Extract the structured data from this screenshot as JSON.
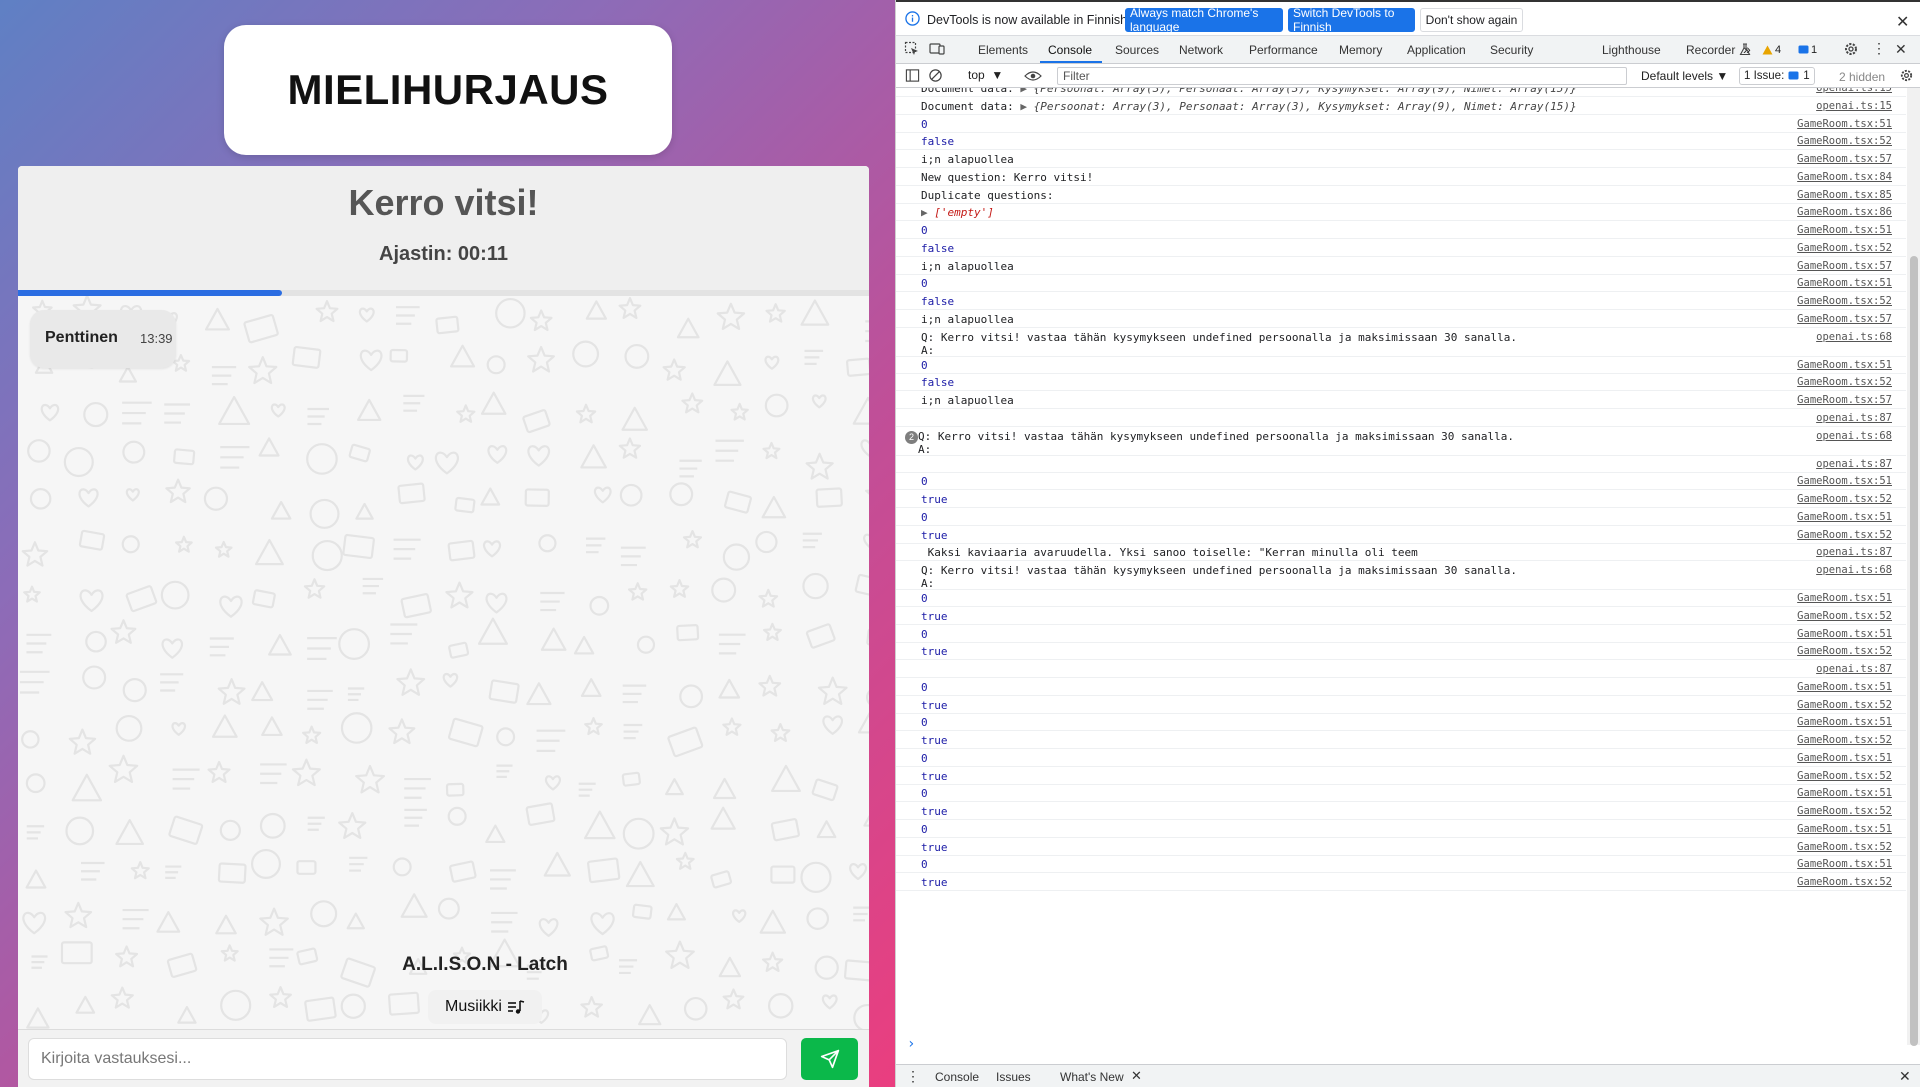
{
  "app": {
    "title": "MIELIHURJAUS",
    "question": "Kerro vitsi!",
    "timer": "Ajastin: 00:11",
    "progress_fraction": 0.31,
    "message": {
      "author": "Penttinen",
      "time": "13:39"
    },
    "song": "A.L.I.S.O.N - Latch",
    "music_label": "Musiikki",
    "input_placeholder": "Kirjoita vastauksesi...",
    "colors": {
      "accent": "#2b6de2",
      "send": "#0bb84a"
    }
  },
  "devtools": {
    "infobar": {
      "message": "DevTools is now available in Finnish!",
      "btn_match": "Always match Chrome's language",
      "btn_switch": "Switch DevTools to Finnish",
      "btn_dismiss": "Don't show again"
    },
    "tabs": [
      "Elements",
      "Console",
      "Sources",
      "Network",
      "Performance",
      "Memory",
      "Application",
      "Security",
      "Lighthouse",
      "Recorder"
    ],
    "active_tab": "Console",
    "warnings_count": "4",
    "info_count": "1",
    "context": "top",
    "filter_placeholder": "Filter",
    "levels": "Default levels",
    "issues_label": "1 Issue:",
    "issues_count": "1",
    "hidden": "2 hidden",
    "drawer_tabs": [
      "Console",
      "Issues",
      "What's New"
    ],
    "logs": [
      {
        "type": "obj",
        "prefix": "Document data: ",
        "text": "{Persoonat: Array(3), Personaat: Array(3), Kysymykset: Array(9), Nimet: Array(15)}",
        "src": "openai.ts:15"
      },
      {
        "type": "obj",
        "prefix": "Document data: ",
        "text": "{Persoonat: Array(3), Personaat: Array(3), Kysymykset: Array(9), Nimet: Array(15)}",
        "src": "openai.ts:15"
      },
      {
        "type": "num",
        "text": "0",
        "src": "GameRoom.tsx:51"
      },
      {
        "type": "bool",
        "text": "false",
        "src": "GameRoom.tsx:52"
      },
      {
        "type": "text",
        "text": "i;n alapuollea",
        "src": "GameRoom.tsx:57"
      },
      {
        "type": "text",
        "text": "New question: Kerro vitsi!",
        "src": "GameRoom.tsx:84"
      },
      {
        "type": "text",
        "text": "Duplicate questions:",
        "src": "GameRoom.tsx:85"
      },
      {
        "type": "arr",
        "text": "['empty']",
        "src": "GameRoom.tsx:86"
      },
      {
        "type": "num",
        "text": "0",
        "src": "GameRoom.tsx:51"
      },
      {
        "type": "bool",
        "text": "false",
        "src": "GameRoom.tsx:52"
      },
      {
        "type": "text",
        "text": "i;n alapuollea",
        "src": "GameRoom.tsx:57"
      },
      {
        "type": "num",
        "text": "0",
        "src": "GameRoom.tsx:51"
      },
      {
        "type": "bool",
        "text": "false",
        "src": "GameRoom.tsx:52"
      },
      {
        "type": "text",
        "text": "i;n alapuollea",
        "src": "GameRoom.tsx:57"
      },
      {
        "type": "text2",
        "text": "Q: Kerro vitsi! vastaa tähän kysymykseen undefined persoonalla ja maksimissaan 30 sanalla.\nA:",
        "src": "openai.ts:68"
      },
      {
        "type": "num",
        "text": "0",
        "src": "GameRoom.tsx:51"
      },
      {
        "type": "bool",
        "text": "false",
        "src": "GameRoom.tsx:52"
      },
      {
        "type": "text",
        "text": "i;n alapuollea",
        "src": "GameRoom.tsx:57"
      },
      {
        "type": "blank",
        "text": "",
        "src": "openai.ts:87"
      },
      {
        "type": "rep2",
        "count": "2",
        "text": "Q: Kerro vitsi! vastaa tähän kysymykseen undefined persoonalla ja maksimissaan 30 sanalla.\nA:",
        "src": "openai.ts:68"
      },
      {
        "type": "blank",
        "text": "",
        "src": "openai.ts:87"
      },
      {
        "type": "num",
        "text": "0",
        "src": "GameRoom.tsx:51"
      },
      {
        "type": "bool",
        "text": "true",
        "src": "GameRoom.tsx:52"
      },
      {
        "type": "num",
        "text": "0",
        "src": "GameRoom.tsx:51"
      },
      {
        "type": "bool",
        "text": "true",
        "src": "GameRoom.tsx:52"
      },
      {
        "type": "text",
        "text": " Kaksi kaviaaria avaruudella. Yksi sanoo toiselle: \"Kerran minulla oli teem",
        "src": "openai.ts:87"
      },
      {
        "type": "text2",
        "text": "Q: Kerro vitsi! vastaa tähän kysymykseen undefined persoonalla ja maksimissaan 30 sanalla.\nA:",
        "src": "openai.ts:68"
      },
      {
        "type": "num",
        "text": "0",
        "src": "GameRoom.tsx:51"
      },
      {
        "type": "bool",
        "text": "true",
        "src": "GameRoom.tsx:52"
      },
      {
        "type": "num",
        "text": "0",
        "src": "GameRoom.tsx:51"
      },
      {
        "type": "bool",
        "text": "true",
        "src": "GameRoom.tsx:52"
      },
      {
        "type": "blank",
        "text": "",
        "src": "openai.ts:87"
      },
      {
        "type": "num",
        "text": "0",
        "src": "GameRoom.tsx:51"
      },
      {
        "type": "bool",
        "text": "true",
        "src": "GameRoom.tsx:52"
      },
      {
        "type": "num",
        "text": "0",
        "src": "GameRoom.tsx:51"
      },
      {
        "type": "bool",
        "text": "true",
        "src": "GameRoom.tsx:52"
      },
      {
        "type": "num",
        "text": "0",
        "src": "GameRoom.tsx:51"
      },
      {
        "type": "bool",
        "text": "true",
        "src": "GameRoom.tsx:52"
      },
      {
        "type": "num",
        "text": "0",
        "src": "GameRoom.tsx:51"
      },
      {
        "type": "bool",
        "text": "true",
        "src": "GameRoom.tsx:52"
      },
      {
        "type": "num",
        "text": "0",
        "src": "GameRoom.tsx:51"
      },
      {
        "type": "bool",
        "text": "true",
        "src": "GameRoom.tsx:52"
      },
      {
        "type": "num",
        "text": "0",
        "src": "GameRoom.tsx:51"
      },
      {
        "type": "bool",
        "text": "true",
        "src": "GameRoom.tsx:52"
      }
    ]
  }
}
